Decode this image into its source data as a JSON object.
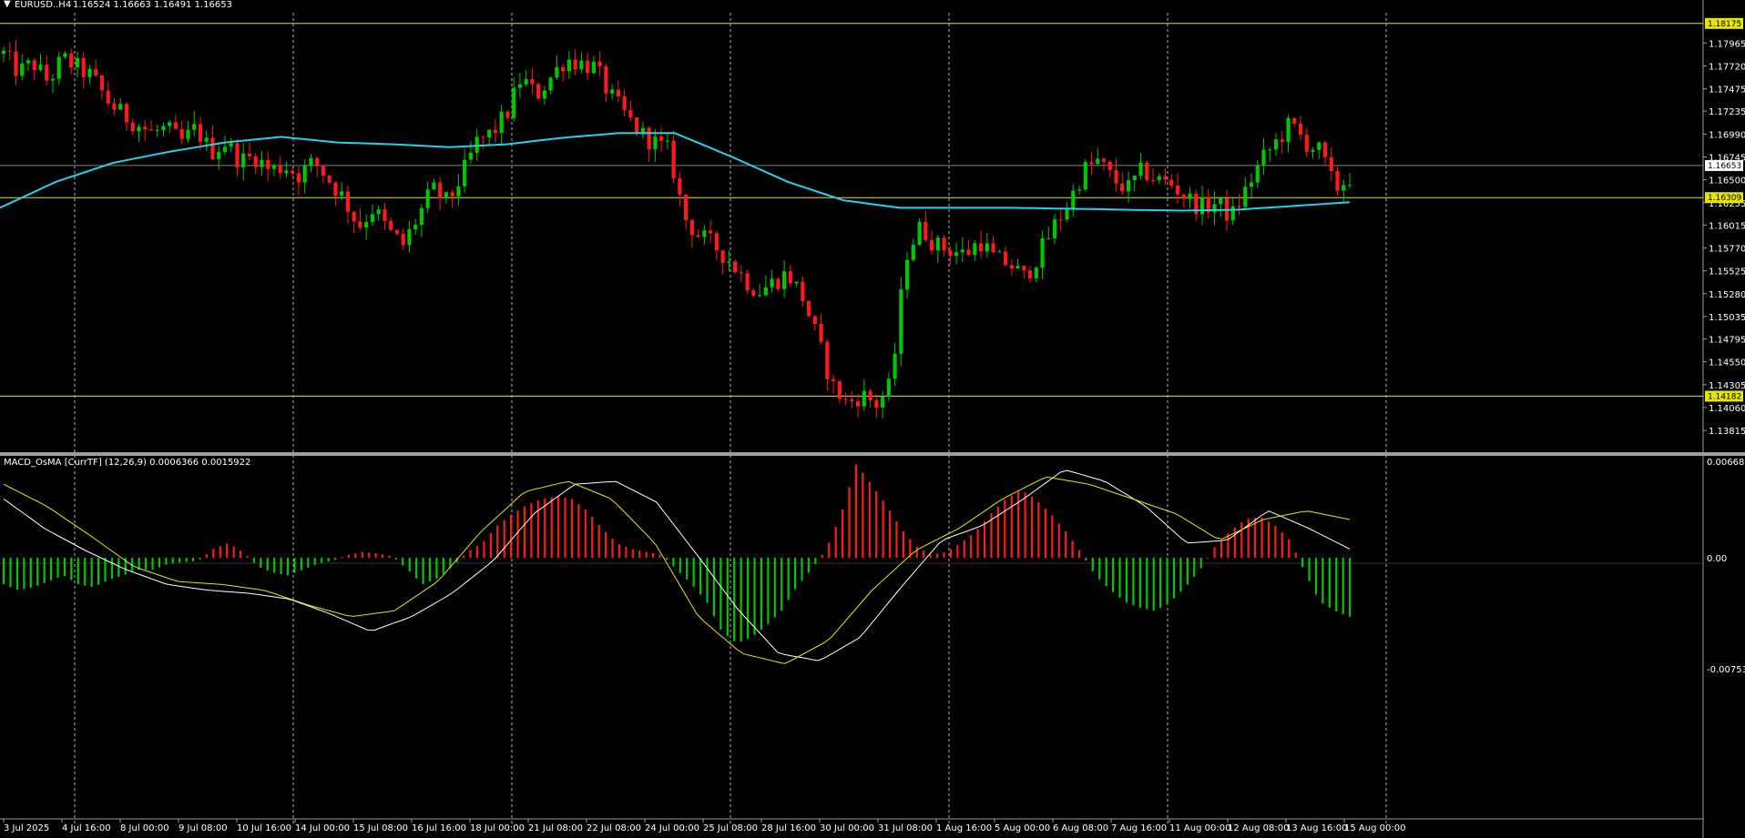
{
  "header": {
    "symbol": "EURUSD..H4",
    "ohlc": "1.16524 1.16663 1.16491 1.16653"
  },
  "colors": {
    "background": "#000000",
    "bull": "#00c800",
    "bear": "#ff1a1a",
    "ma": "#22d3ee",
    "hline": "#e6e600",
    "grid": "#ffffff",
    "macd_main": "#ffffff",
    "macd_signal": "#e6e600",
    "current_price_line": "#808080"
  },
  "chart_data": [
    {
      "type": "candlestick",
      "title": "EURUSD..H4",
      "ylim": [
        1.1365,
        1.1829
      ],
      "price_ticks": [
        "1.17965",
        "1.17720",
        "1.17475",
        "1.17235",
        "1.16990",
        "1.16745",
        "1.16500",
        "1.16255",
        "1.16015",
        "1.15770",
        "1.15525",
        "1.15280",
        "1.15035",
        "1.14795",
        "1.14550",
        "1.14305",
        "1.14060",
        "1.13815"
      ],
      "time_labels": [
        "3 Jul 2025",
        "4 Jul 16:00",
        "8 Jul 00:00",
        "9 Jul 08:00",
        "10 Jul 16:00",
        "14 Jul 00:00",
        "15 Jul 08:00",
        "16 Jul 16:00",
        "18 Jul 00:00",
        "21 Jul 08:00",
        "22 Jul 08:00",
        "24 Jul 00:00",
        "25 Jul 08:00",
        "28 Jul 16:00",
        "30 Jul 00:00",
        "31 Jul 08:00",
        "1 Aug 16:00",
        "5 Aug 00:00",
        "6 Aug 08:00",
        "7 Aug 16:00",
        "11 Aug 00:00",
        "12 Aug 08:00",
        "13 Aug 16:00",
        "15 Aug 00:00"
      ],
      "horizontal_levels": [
        {
          "label": "1.18175",
          "value": 1.18175,
          "highlight": true
        },
        {
          "label": "1.16653",
          "value": 1.16653,
          "highlight": false
        },
        {
          "label": "1.16309",
          "value": 1.16309,
          "highlight": true
        },
        {
          "label": "1.14182",
          "value": 1.14182,
          "highlight": true
        }
      ],
      "close_path": [
        1.1785,
        1.1765,
        1.1775,
        1.1755,
        1.178,
        1.177,
        1.176,
        1.1735,
        1.172,
        1.171,
        1.17,
        1.1705,
        1.169,
        1.1705,
        1.168,
        1.169,
        1.167,
        1.1675,
        1.166,
        1.1665,
        1.1655,
        1.167,
        1.165,
        1.163,
        1.16,
        1.162,
        1.1595,
        1.158,
        1.161,
        1.164,
        1.1625,
        1.1655,
        1.169,
        1.17,
        1.172,
        1.176,
        1.174,
        1.176,
        1.178,
        1.1775,
        1.177,
        1.174,
        1.172,
        1.17,
        1.169,
        1.168,
        1.161,
        1.159,
        1.158,
        1.1565,
        1.1545,
        1.153,
        1.154,
        1.155,
        1.1525,
        1.148,
        1.143,
        1.141,
        1.142,
        1.141,
        1.143,
        1.157,
        1.16,
        1.158,
        1.1575,
        1.157,
        1.1585,
        1.1565,
        1.156,
        1.1545,
        1.157,
        1.16,
        1.1625,
        1.166,
        1.167,
        1.165,
        1.164,
        1.166,
        1.165,
        1.1645,
        1.163,
        1.162,
        1.1625,
        1.161,
        1.164,
        1.167,
        1.169,
        1.171,
        1.169,
        1.168,
        1.164,
        1.1653
      ],
      "ma_path": [
        1.162,
        1.1648,
        1.1668,
        1.168,
        1.169,
        1.1696,
        1.169,
        1.1688,
        1.1685,
        1.1688,
        1.1695,
        1.17,
        1.17,
        1.1675,
        1.1648,
        1.1628,
        1.162,
        1.162,
        1.162,
        1.1619,
        1.1618,
        1.1617,
        1.1618,
        1.1622,
        1.1626
      ],
      "ma_period_label": ""
    },
    {
      "type": "bar",
      "title": "MACD_OsMA [CurrTF] (12,26,9) 0.0006366 0.0015922",
      "ylim": [
        -0.007538,
        0.006683
      ],
      "scale_labels": [
        "0.006683",
        "0.00",
        "-0.007538"
      ],
      "histogram": [
        -0.0018,
        -0.0022,
        -0.002,
        -0.0016,
        -0.0012,
        -0.0018,
        -0.002,
        -0.0015,
        -0.0012,
        -0.0008,
        -0.0008,
        -0.0004,
        -0.0003,
        -0.0002,
        0.0006,
        0.001,
        0.0004,
        -0.0006,
        -0.001,
        -0.0012,
        -0.0008,
        -0.0004,
        -0.0002,
        0.0002,
        0.0004,
        0.0003,
        0.0001,
        -0.0008,
        -0.0018,
        -0.0014,
        -0.0006,
        0.0004,
        0.001,
        0.0022,
        0.003,
        0.0036,
        0.004,
        0.0042,
        0.004,
        0.0032,
        0.002,
        0.001,
        0.0006,
        0.0004,
        0.0002,
        -0.0008,
        -0.0018,
        -0.003,
        -0.005,
        -0.0058,
        -0.0054,
        -0.0046,
        -0.0036,
        -0.002,
        -0.0008,
        0.0006,
        0.003,
        0.0064,
        0.005,
        0.0036,
        0.002,
        0.0008,
        0.0002,
        0.0004,
        0.001,
        0.0018,
        0.003,
        0.004,
        0.0046,
        0.004,
        0.003,
        0.0018,
        0.0004,
        -0.0012,
        -0.0022,
        -0.003,
        -0.0034,
        -0.0036,
        -0.003,
        -0.002,
        -0.0008,
        0.0008,
        0.0018,
        0.0026,
        0.0028,
        0.0022,
        0.0012,
        -0.001,
        -0.003,
        -0.0036,
        -0.004
      ],
      "main_path": [
        0.004,
        0.002,
        0.0005,
        -0.0008,
        -0.0018,
        -0.0022,
        -0.0024,
        -0.0028,
        -0.0038,
        -0.005,
        -0.004,
        -0.0024,
        -0.0002,
        0.003,
        0.005,
        0.0052,
        0.0038,
        0.0002,
        -0.0035,
        -0.0065,
        -0.007,
        -0.0054,
        -0.002,
        0.0012,
        0.0022,
        0.004,
        0.006,
        0.0052,
        0.0035,
        0.001,
        0.0012,
        0.0032,
        0.002,
        0.0006
      ],
      "signal_path": [
        0.005,
        0.0035,
        0.0015,
        -0.0006,
        -0.0016,
        -0.0018,
        -0.0022,
        -0.0032,
        -0.004,
        -0.0036,
        -0.0016,
        0.0018,
        0.0045,
        0.0052,
        0.004,
        0.001,
        -0.004,
        -0.0065,
        -0.0072,
        -0.0056,
        -0.0022,
        0.0005,
        0.002,
        0.004,
        0.0055,
        0.005,
        0.004,
        0.003,
        0.0012,
        0.0026,
        0.0032,
        0.0026
      ]
    }
  ]
}
